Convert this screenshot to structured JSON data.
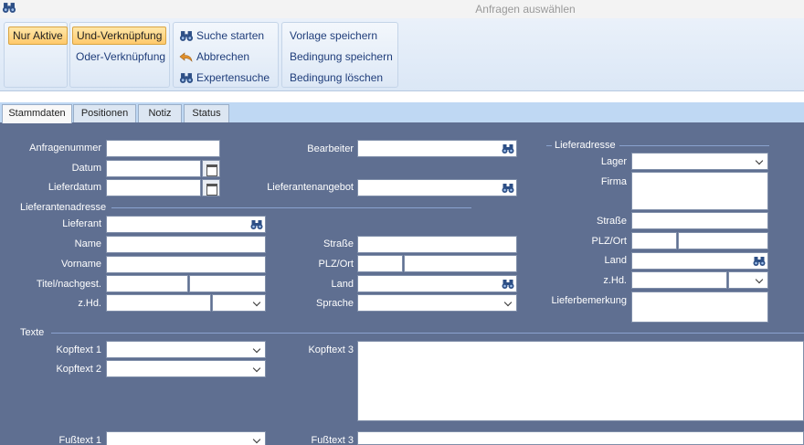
{
  "window": {
    "title": "Anfragen auswählen"
  },
  "ribbon": {
    "nur_aktive": "Nur Aktive",
    "und_verknuepfung": "Und-Verknüpfung",
    "oder_verknuepfung": "Oder-Verknüpfung",
    "suche_starten": "Suche starten",
    "abbrechen": "Abbrechen",
    "expertensuche": "Expertensuche",
    "vorlage_speichern": "Vorlage speichern",
    "bedingung_speichern": "Bedingung speichern",
    "bedingung_loeschen": "Bedingung löschen"
  },
  "tabs": [
    "Stammdaten",
    "Positionen",
    "Notiz",
    "Status"
  ],
  "form": {
    "anfragenummer": "Anfragenummer",
    "datum": "Datum",
    "lieferdatum": "Lieferdatum",
    "bearbeiter": "Bearbeiter",
    "lieferantenangebot": "Lieferantenangebot",
    "lieferantenadresse": "Lieferantenadresse",
    "lieferant": "Lieferant",
    "name": "Name",
    "vorname": "Vorname",
    "titel": "Titel/nachgest.",
    "zhd": "z.Hd.",
    "strasse": "Straße",
    "plz_ort": "PLZ/Ort",
    "land": "Land",
    "sprache": "Sprache",
    "lieferadresse": "Lieferadresse",
    "lager": "Lager",
    "firma": "Firma",
    "lief_strasse": "Straße",
    "lief_plz_ort": "PLZ/Ort",
    "lief_land": "Land",
    "lief_zhd": "z.Hd.",
    "lieferbemerkung": "Lieferbemerkung",
    "texte": "Texte",
    "kopftext1": "Kopftext 1",
    "kopftext2": "Kopftext 2",
    "kopftext3": "Kopftext 3",
    "fusstext1": "Fußtext 1",
    "fusstext3": "Fußtext 3"
  },
  "colors": {
    "form_bg": "#5f6f91",
    "ribbon_active": "#ffc96b",
    "ribbon_text": "#1f3d7a"
  }
}
